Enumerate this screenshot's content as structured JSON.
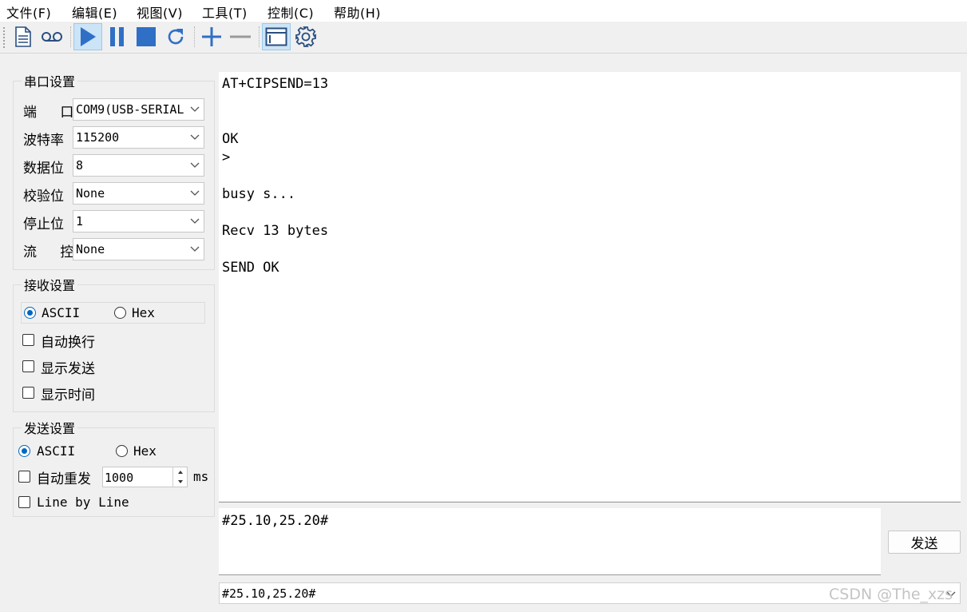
{
  "menu": [
    "文件(F)",
    "编辑(E)",
    "视图(V)",
    "工具(T)",
    "控制(C)",
    "帮助(H)"
  ],
  "toolbar_icons": [
    "new-file-icon",
    "record-icon",
    "play-icon",
    "pause-icon",
    "stop-icon",
    "refresh-icon",
    "add-icon",
    "remove-icon",
    "window-icon",
    "settings-gear-icon"
  ],
  "accent_color": "#2f6fc6",
  "serial": {
    "legend": "串口设置",
    "port_label": "端  口",
    "port_value": "COM9(USB-SERIAL",
    "baud_label": "波特率",
    "baud_value": "115200",
    "data_label": "数据位",
    "data_value": "8",
    "parity_label": "校验位",
    "parity_value": "None",
    "stop_label": "停止位",
    "stop_value": "1",
    "flow_label": "流  控",
    "flow_value": "None"
  },
  "receive": {
    "legend": "接收设置",
    "ascii_label": "ASCII",
    "hex_label": "Hex",
    "mode": "ASCII",
    "auto_wrap_label": "自动换行",
    "show_send_label": "显示发送",
    "show_time_label": "显示时间"
  },
  "send": {
    "legend": "发送设置",
    "ascii_label": "ASCII",
    "hex_label": "Hex",
    "mode": "ASCII",
    "auto_resend_label": "自动重发",
    "interval_value": "1000",
    "interval_unit": "ms",
    "line_by_line_label": "Line by Line",
    "input_text": "#25.10,25.20#",
    "send_button_label": "发送",
    "history_value": "#25.10,25.20#"
  },
  "recv_lines": [
    "AT+CIPSEND=13",
    "OK",
    ">",
    "busy s...",
    "Recv 13 bytes",
    "SEND OK"
  ],
  "watermark": "CSDN @The_xzs"
}
